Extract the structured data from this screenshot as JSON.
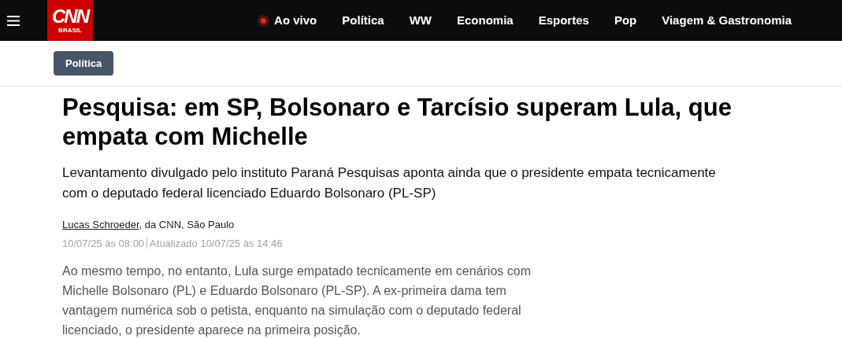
{
  "header": {
    "logo": {
      "text": "CNN",
      "subtext": "BRASIL"
    },
    "nav": [
      {
        "label": "Ao vivo",
        "kind": "live"
      },
      {
        "label": "Política",
        "kind": "link"
      },
      {
        "label": "WW",
        "kind": "link"
      },
      {
        "label": "Economia",
        "kind": "link"
      },
      {
        "label": "Esportes",
        "kind": "link"
      },
      {
        "label": "Pop",
        "kind": "link"
      },
      {
        "label": "Viagem & Gastronomia",
        "kind": "link"
      }
    ]
  },
  "category": "Política",
  "article": {
    "headline": "Pesquisa: em SP, Bolsonaro e Tarcísio superam Lula, que empata com Michelle",
    "subtitle": "Levantamento divulgado pelo instituto Paraná Pesquisas aponta ainda que o presidente empata tecnicamente com o deputado federal licenciado Eduardo Bolsonaro (PL-SP)",
    "author": "Lucas Schroeder",
    "byline_rest": ", da CNN, São Paulo",
    "published": "10/07/25 às 08:00",
    "updated": "Atualizado 10/07/25 às 14:46",
    "body": "Ao mesmo tempo, no entanto, Lula surge empatado tecnicamente em cenários com Michelle Bolsonaro (PL) e Eduardo Bolsonaro (PL-SP). A ex-primeira dama tem vantagem numérica sob o petista, enquanto na simulação com o deputado federal licenciado, o presidente aparece na primeira posição."
  }
}
